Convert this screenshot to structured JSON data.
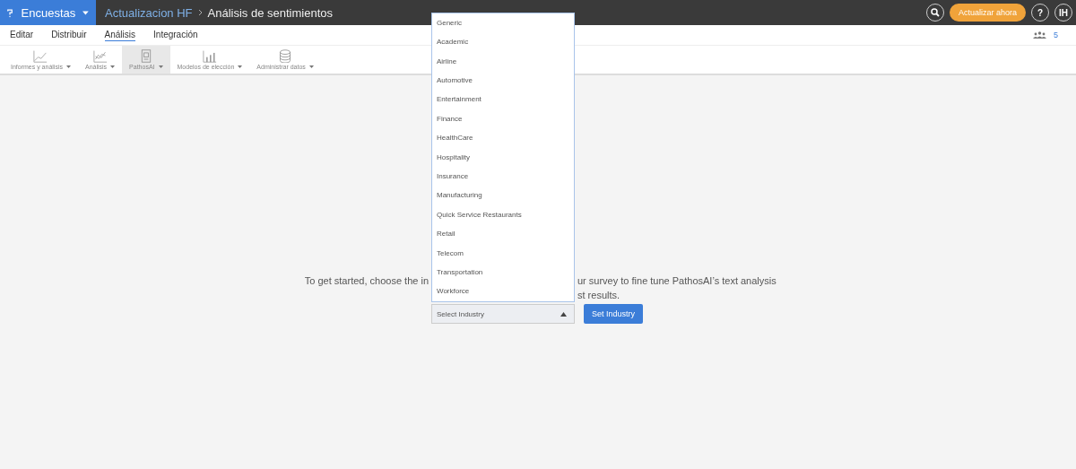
{
  "header": {
    "product": "Encuestas",
    "breadcrumb": [
      "Actualizacion HF",
      "Análisis de sentimientos"
    ],
    "upgrade_button": "Actualizar ahora",
    "help": "?",
    "avatar": "IH"
  },
  "tabs": [
    {
      "label": "Editar",
      "selected": false
    },
    {
      "label": "Distribuir",
      "selected": false
    },
    {
      "label": "Análisis",
      "selected": true
    },
    {
      "label": "Integración",
      "selected": false
    }
  ],
  "collaborators": {
    "count": "5"
  },
  "toolbar": [
    {
      "label": "Informes y análisis",
      "kind": "line",
      "selected": false
    },
    {
      "label": "Análisis",
      "kind": "trend",
      "selected": false
    },
    {
      "label": "PathosAI",
      "kind": "doc",
      "selected": true
    },
    {
      "label": "Modelos de elección",
      "kind": "bars",
      "selected": false
    },
    {
      "label": "Administrar datos",
      "kind": "db",
      "selected": false
    }
  ],
  "intro": {
    "line_1_left": "To get started, choose the in",
    "line_1_right": "ur survey to fine tune PathosAI’s text analysis",
    "line_2_right": "st results."
  },
  "industry_select": {
    "placeholder": "Select Industry",
    "expanded": true,
    "options": [
      "Generic",
      "Academic",
      "Airline",
      "Automotive",
      "Entertainment",
      "Finance",
      "HealthCare",
      "Hospitality",
      "Insurance",
      "Manufacturing",
      "Quick Service Restaurants",
      "Retail",
      "Telecom",
      "Transportation",
      "Workforce"
    ]
  },
  "set_button": "Set Industry"
}
